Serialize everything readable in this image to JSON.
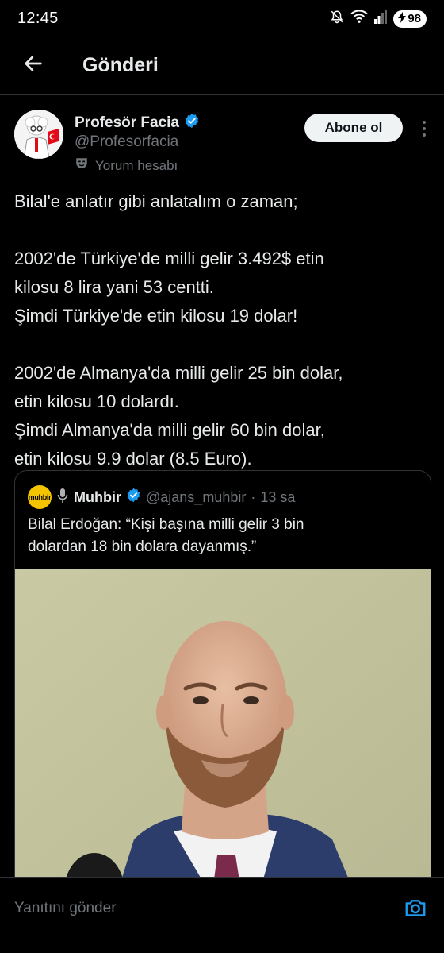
{
  "status_bar": {
    "time": "12:45",
    "battery": "98"
  },
  "header": {
    "title": "Gönderi"
  },
  "author": {
    "name": "Profesör Facia",
    "handle": "@Profesorfacia",
    "account_label": "Yorum hesabı",
    "verified": true
  },
  "follow_button": {
    "label": "Abone ol"
  },
  "tweet": {
    "lines": [
      "Bilal'e anlatır gibi anlatalım o zaman;",
      "",
      "2002'de Türkiye'de milli gelir 3.492$ etin",
      "kilosu 8 lira yani 53 centti.",
      "Şimdi Türkiye'de etin kilosu 19 dolar!",
      "",
      "2002'de Almanya'da milli gelir 25 bin dolar,",
      "etin kilosu 10 dolardı.",
      "Şimdi Almanya'da milli gelir 60 bin dolar,",
      "etin kilosu 9.9 dolar (8.5 Euro)."
    ]
  },
  "quote": {
    "avatar_text": "muhbir",
    "name": "Muhbir",
    "handle": "@ajans_muhbir",
    "separator": "·",
    "time": "13 sa",
    "text_lines": [
      "Bilal Erdoğan: “Kişi başına milli gelir 3 bin",
      "dolardan 18 bin dolara dayanmış.”"
    ]
  },
  "reply": {
    "placeholder": "Yanıtını gönder"
  },
  "colors": {
    "background": "#000000",
    "text": "#e7e9ea",
    "secondary_text": "#71767b",
    "verified_blue": "#1d9bf0",
    "accent_blue": "#1d9bf0",
    "border": "#2f3336"
  },
  "icons": [
    "back-arrow-icon",
    "verified-badge-icon",
    "theater-mask-icon",
    "more-vertical-icon",
    "microphone-icon",
    "camera-icon",
    "wifi-icon",
    "signal-icon",
    "bell-off-icon",
    "battery-bolt-icon"
  ]
}
